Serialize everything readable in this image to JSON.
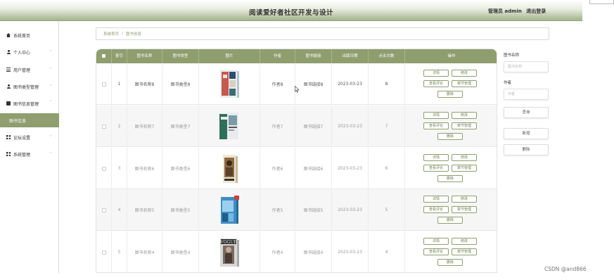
{
  "header": {
    "title": "阅读爱好者社区开发与设计",
    "user_label": "管理员 admin",
    "logout_label": "退出登录"
  },
  "sidebar": {
    "items": [
      {
        "label": "系统首页",
        "icon": "home-icon"
      },
      {
        "label": "个人中心",
        "icon": "user-icon"
      },
      {
        "label": "用户管理",
        "icon": "list-icon"
      },
      {
        "label": "图书类型管理",
        "icon": "user-icon"
      },
      {
        "label": "图书信息管理",
        "icon": "book-icon"
      },
      {
        "label": "图书信息",
        "icon": ""
      },
      {
        "label": "论坛设置",
        "icon": "grid-icon"
      },
      {
        "label": "系统管理",
        "icon": "grid-icon"
      }
    ]
  },
  "breadcrumb": {
    "home": "系统首页",
    "separator": "/",
    "current": "图书信息"
  },
  "table": {
    "columns": [
      "",
      "索引",
      "图书名称",
      "图书类型",
      "图片",
      "作者",
      "图书链接",
      "出版日期",
      "点击次数",
      "操作"
    ],
    "rows": [
      {
        "index": "1",
        "name": "图书名称8",
        "type": "图书类型8",
        "author": "作者8",
        "link": "图书链接8",
        "date": "2023-03-23",
        "clicks": "8",
        "cover": "book-cover-red"
      },
      {
        "index": "2",
        "name": "图书名称7",
        "type": "图书类型7",
        "author": "作者7",
        "link": "图书链接7",
        "date": "2023-03-23",
        "clicks": "7",
        "cover": "book-cover-green"
      },
      {
        "index": "3",
        "name": "图书名称6",
        "type": "图书类型6",
        "author": "作者6",
        "link": "图书链接6",
        "date": "2023-03-23",
        "clicks": "6",
        "cover": "book-cover-brown"
      },
      {
        "index": "4",
        "name": "图书名称5",
        "type": "图书类型5",
        "author": "作者5",
        "link": "图书链接5",
        "date": "2023-03-23",
        "clicks": "5",
        "cover": "book-cover-blue"
      },
      {
        "index": "5",
        "name": "图书名称4",
        "type": "图书类型4",
        "author": "作者4",
        "link": "图书链接4",
        "date": "2023-03-23",
        "clicks": "4",
        "cover": "book-cover-magazine"
      }
    ],
    "actions": {
      "detail": "详情",
      "edit": "修改",
      "comments": "查看评论",
      "chapters": "章节管理",
      "delete": "删除"
    }
  },
  "search": {
    "name_label": "图书名称",
    "name_placeholder": "图书名称",
    "author_label": "作者",
    "author_placeholder": "作者",
    "query_label": "查询",
    "add_label": "新增",
    "delete_label": "删除"
  },
  "watermark": "CSDN @and866",
  "colors": {
    "accent": "#8e9e6d",
    "header_gradient_end": "#a3b28c"
  }
}
